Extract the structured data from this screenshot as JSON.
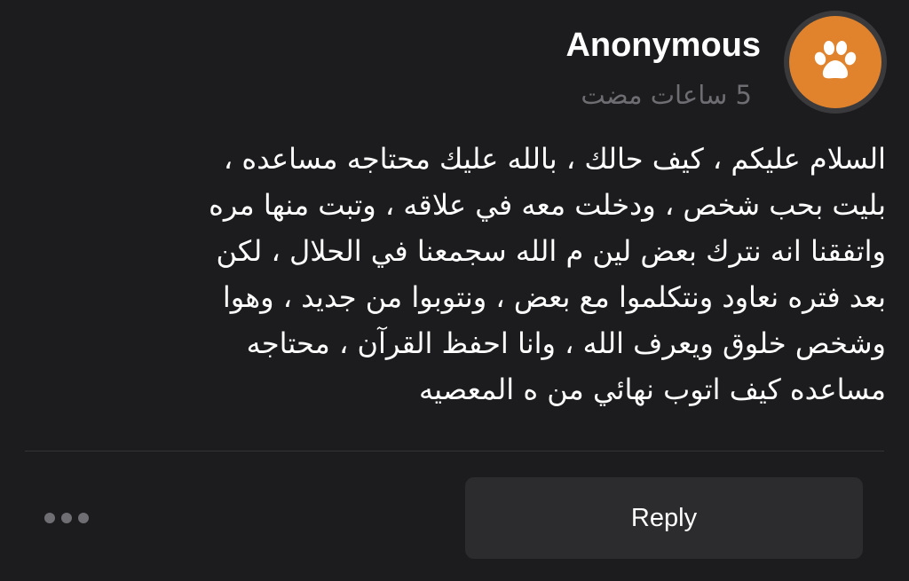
{
  "post": {
    "author": "Anonymous",
    "timestamp": "5 ساعات مضت",
    "avatar_icon": "paw-icon",
    "avatar_color": "#e0832c",
    "message": "السلام عليكم ، كيف حالك ، بالله عليك محتاجه مساعده ،\nبليت بحب شخص ، ودخلت معه في علاقه ، وتبت منها مره\nواتفقنا انه نترك بعض لين م الله سجمعنا في الحلال ، لكن\nبعد فتره نعاود ونتكلموا مع بعض ، ونتوبوا من جديد ، وهوا\nوشخص خلوق ويعرف الله ، وانا احفظ القرآن ، محتاجه\nمساعده كيف اتوب نهائي من ه المعصيه"
  },
  "actions": {
    "more_icon": "more-dots-icon",
    "reply_label": "Reply"
  }
}
